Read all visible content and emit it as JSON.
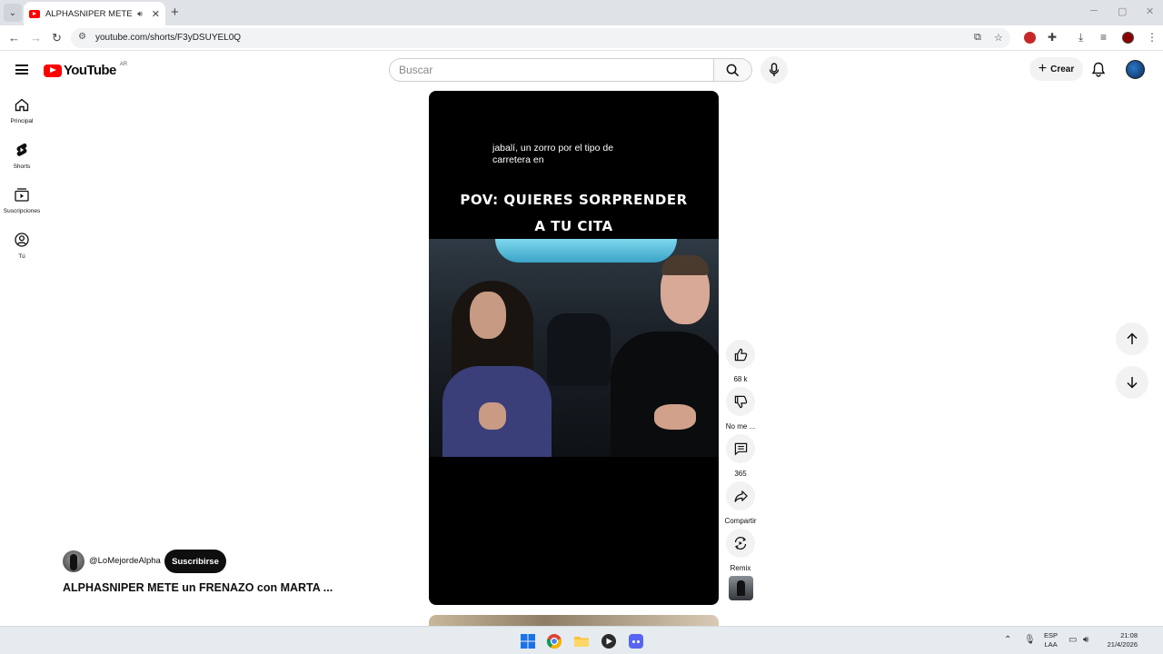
{
  "browser": {
    "tab_title": "ALPHASNIPER METE un FRENAZO con MARTA",
    "tab_close": "✕",
    "new_tab": "+",
    "url": "youtube.com/shorts/F3yDSUYEL0Q"
  },
  "header": {
    "logo_text": "YouTube",
    "country_code": "AR",
    "search_placeholder": "Buscar",
    "create_label": "Crear"
  },
  "sidebar": {
    "items": [
      {
        "label": "Principal",
        "icon": "home-icon"
      },
      {
        "label": "Shorts",
        "icon": "shorts-icon"
      },
      {
        "label": "Suscripciones",
        "icon": "subscriptions-icon"
      },
      {
        "label": "Tú",
        "icon": "you-icon"
      }
    ]
  },
  "video": {
    "caption": "jabalí, un zorro por el tipo de carretera en",
    "overlay_line1": "POV: QUIERES SORPRENDER",
    "overlay_line2": "A TU CITA"
  },
  "actions": {
    "likes": "68 k",
    "dislike_label": "No me ...",
    "comments": "365",
    "share_label": "Compartir",
    "remix_label": "Remix"
  },
  "channel": {
    "handle": "@LoMejordeAlpha",
    "subscribe_label": "Suscribirse",
    "video_title": "ALPHASNIPER METE un FRENAZO con MARTA ..."
  },
  "taskbar": {
    "lang_line1": "ESP",
    "lang_line2": "LAA",
    "time": "21:08",
    "date": "21/4/2026"
  },
  "colors": {
    "brand_red": "#ff0000",
    "text_primary": "#0f0f0f",
    "button_bg": "#f2f2f2"
  }
}
